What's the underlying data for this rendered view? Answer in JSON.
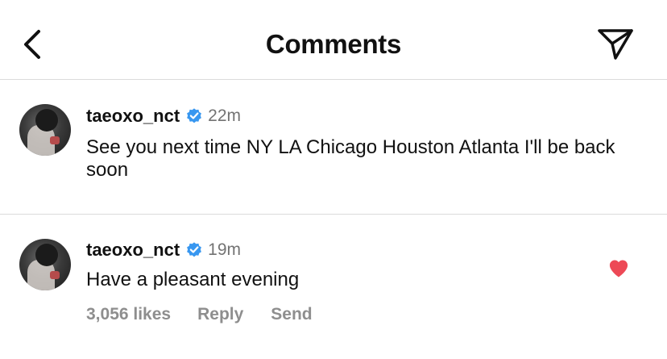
{
  "header": {
    "title": "Comments",
    "back_icon": "chevron-left-icon",
    "share_icon": "paper-plane-icon"
  },
  "comments": [
    {
      "username": "taeoxo_nct",
      "verified": true,
      "time": "22m",
      "text": "See you next time NY LA Chicago Houston Atlanta I'll be back soon"
    },
    {
      "username": "taeoxo_nct",
      "verified": true,
      "time": "19m",
      "text": "Have a pleasant evening",
      "likes": "3,056 likes",
      "reply_label": "Reply",
      "send_label": "Send",
      "liked": true
    }
  ],
  "colors": {
    "verified": "#3897f0",
    "like": "#ed4956",
    "muted": "#737373",
    "divider": "#dbdbdb"
  }
}
